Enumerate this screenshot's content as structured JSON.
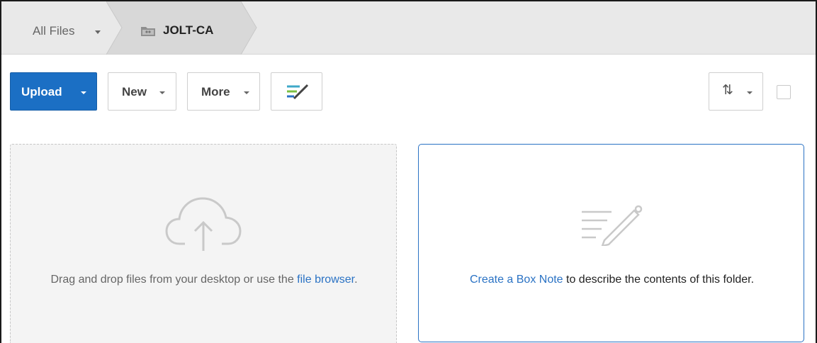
{
  "breadcrumb": {
    "root_label": "All Files",
    "current_label": "JOLT-CA"
  },
  "toolbar": {
    "upload_label": "Upload",
    "new_label": "New",
    "more_label": "More",
    "sort_icon": "sort-arrows-icon",
    "notes_icon": "box-notes-icon"
  },
  "drop_panel": {
    "text_before": "Drag and drop files from your desktop or use the ",
    "link": "file browser",
    "text_after": "."
  },
  "note_panel": {
    "link": "Create a Box Note",
    "text_after": " to describe the contents of this folder."
  },
  "colors": {
    "accent": "#1b6fc4",
    "link": "#2a72c4",
    "breadcrumb_bg": "#e9e9e9"
  }
}
